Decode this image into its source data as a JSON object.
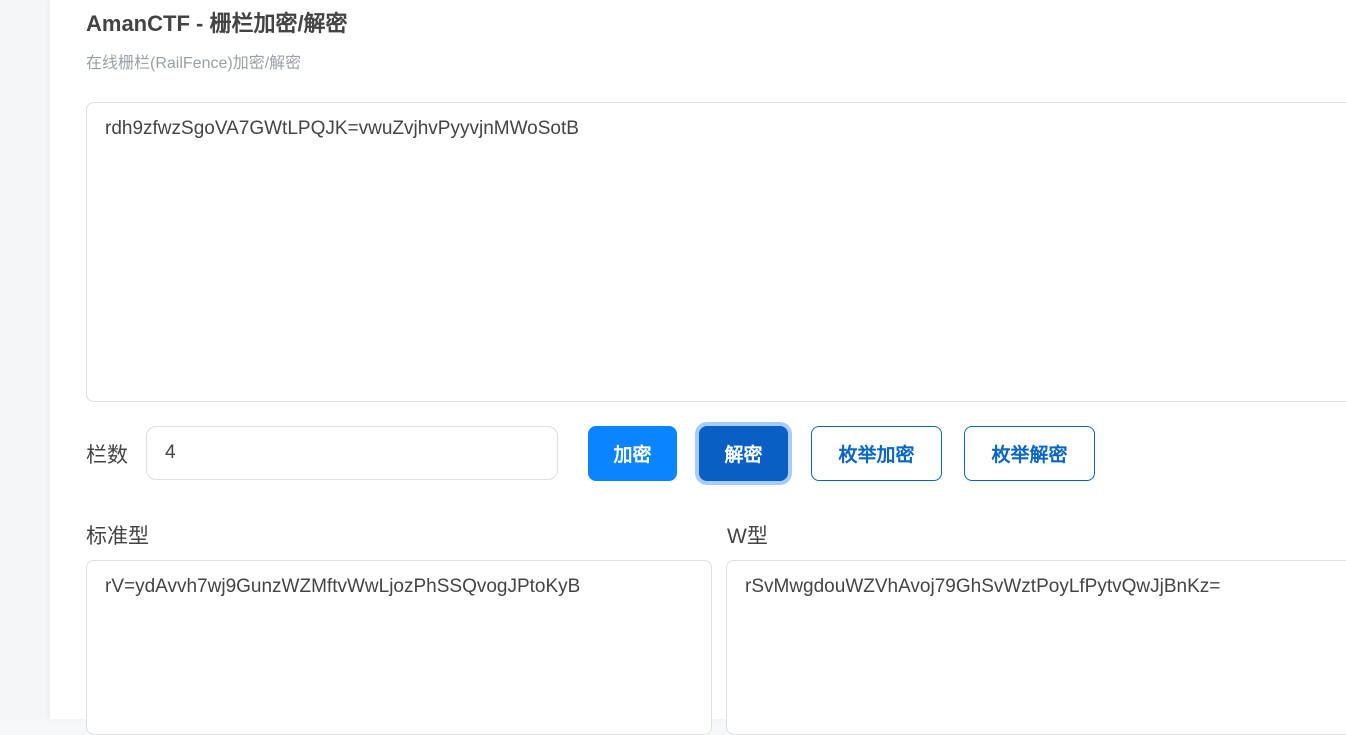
{
  "header": {
    "title": "AmanCTF - 栅栏加密/解密",
    "subtitle": "在线栅栏(RailFence)加密/解密"
  },
  "input": {
    "value": "rdh9zfwzSgoVA7GWtLPQJK=vwuZvjhvPyyvjnMWoSotB"
  },
  "controls": {
    "rails_label": "栏数",
    "rails_value": "4",
    "encrypt_label": "加密",
    "decrypt_label": "解密",
    "enum_encrypt_label": "枚举加密",
    "enum_decrypt_label": "枚举解密"
  },
  "results": {
    "standard_label": "标准型",
    "standard_value": "rV=ydAvvh7wj9GunzWZMftvWwLjozPhSSQvogJPtoKyB",
    "w_label": "W型",
    "w_value": "rSvMwgdouWZVhAvoj79GhSvWztPoyLfPytvQwJjBnKz="
  },
  "colors": {
    "primary": "#0a84ff",
    "primary_active": "#0a5fc4",
    "outline": "#0a66c2"
  }
}
